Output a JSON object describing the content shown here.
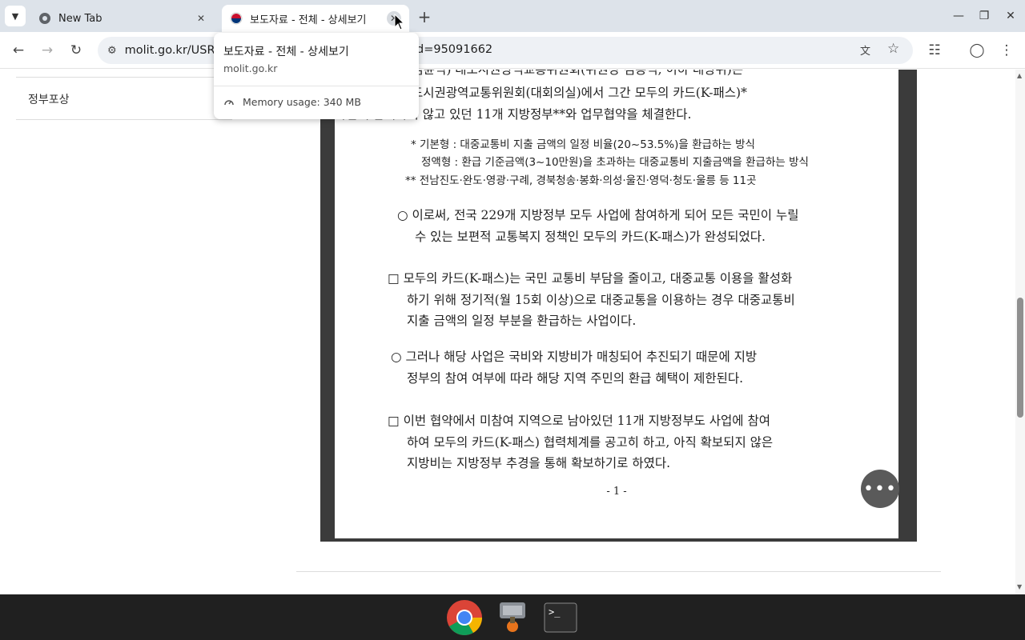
{
  "browser": {
    "tabs": [
      {
        "title": "New Tab",
        "active": false
      },
      {
        "title": "보도자료 - 전체 - 상세보기",
        "active": true
      }
    ],
    "address_bar": {
      "url_visible_start": "molit.go.kr/USR",
      "url_visible_end": "d=95091662"
    }
  },
  "hover_card": {
    "title": "보도자료 - 전체 - 상세보기",
    "domain": "molit.go.kr",
    "memory": "Memory usage: 340 MB"
  },
  "sidebar": {
    "item": "정부포상"
  },
  "document": {
    "line0": "토교통부(장관 김윤덕) 대도시권광역교통위원회(위원장 김용석, 이하 대광위)는",
    "line1": "월 3일 오후 대도시권광역교통위원회(대회의실)에서 그간 모두의 카드(K-패스)*",
    "line2": "사업에 참여하지 않고 있던 11개 지방정부**와 업무협약을 체결한다.",
    "fn1": "* 기본형 : 대중교통비 지출 금액의 일정 비율(20~53.5%)을 환급하는 방식",
    "fn2": "정액형 : 환급 기준금액(3~10만원)을 초과하는 대중교통비 지출금액을 환급하는 방식",
    "fn3": "** 전남진도·완도·영광·구례, 경북청송·봉화·의성·울진·영덕·청도·울릉 등 11곳",
    "p1a": "○  이로써, 전국 229개 지방정부 모두 사업에 참여하게 되어 모든 국민이 누릴",
    "p1b": "수 있는 보편적 교통복지 정책인 모두의 카드(K-패스)가 완성되었다.",
    "p2a": "□  모두의 카드(K-패스)는 국민 교통비 부담을 줄이고, 대중교통 이용을 활성화",
    "p2b": "하기 위해 정기적(월 15회 이상)으로 대중교통을 이용하는 경우 대중교통비",
    "p2c": "지출 금액의 일정 부분을 환급하는 사업이다.",
    "p3a": "○  그러나 해당 사업은 국비와 지방비가 매칭되어 추진되기 때문에 지방",
    "p3b": "정부의 참여 여부에 따라 해당 지역 주민의 환급 혜택이 제한된다.",
    "p4a": "□  이번 협약에서 미참여 지역으로 남아있던 11개 지방정부도 사업에 참여",
    "p4b": "하여 모두의 카드(K-패스) 협력체계를 공고히 하고, 아직 확보되지 않은",
    "p4c": "지방비는 지방정부 추경을 통해 확보하기로 하였다.",
    "page_number": "- 1 -"
  },
  "fab": {
    "label": "•••"
  },
  "taskbar": {
    "apps": [
      "chrome-app",
      "launcher-app",
      "terminal-app"
    ]
  },
  "colors": {
    "tabstrip": "#dde3ea",
    "viewer_bg": "#3b3b3b",
    "taskbar": "#202020"
  }
}
